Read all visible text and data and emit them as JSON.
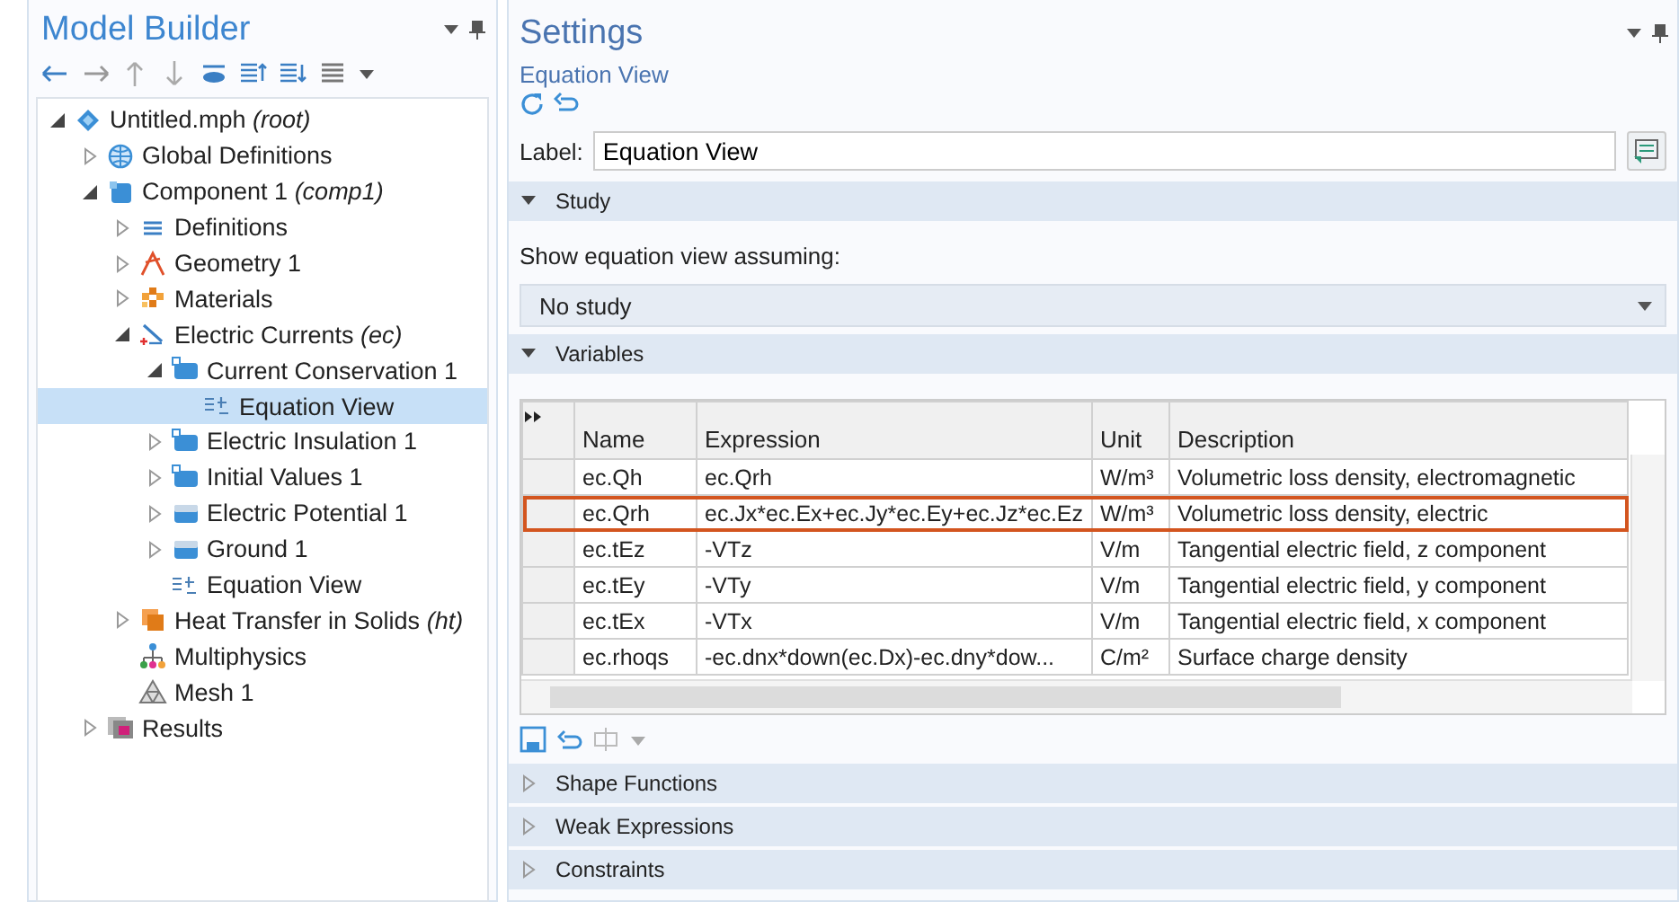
{
  "model_builder": {
    "title": "Model Builder",
    "tree": [
      {
        "label": "Untitled.mph *(root)*",
        "kind": "model",
        "expanded": true,
        "selected": false,
        "children": [
          {
            "label": "Global Definitions",
            "kind": "globe",
            "expanded": false,
            "selected": false
          },
          {
            "label": "Component 1 *(comp1)*",
            "kind": "component",
            "expanded": true,
            "selected": false,
            "children": [
              {
                "label": "Definitions",
                "kind": "list",
                "expanded": false,
                "selected": false
              },
              {
                "label": "Geometry 1",
                "kind": "geometry",
                "expanded": false,
                "selected": false
              },
              {
                "label": "Materials",
                "kind": "materials",
                "expanded": false,
                "selected": false
              },
              {
                "label": "Electric Currents *(ec)*",
                "kind": "physics",
                "expanded": true,
                "selected": false,
                "children": [
                  {
                    "label": "Current Conservation 1",
                    "kind": "domain",
                    "expanded": true,
                    "selected": false,
                    "children": [
                      {
                        "label": "Equation View",
                        "kind": "equation",
                        "selected": true
                      }
                    ]
                  },
                  {
                    "label": "Electric Insulation 1",
                    "kind": "domain",
                    "expanded": false,
                    "selected": false
                  },
                  {
                    "label": "Initial Values 1",
                    "kind": "domain",
                    "expanded": false,
                    "selected": false
                  },
                  {
                    "label": "Electric Potential 1",
                    "kind": "boundary",
                    "expanded": false,
                    "selected": false
                  },
                  {
                    "label": "Ground 1",
                    "kind": "boundary",
                    "expanded": false,
                    "selected": false
                  },
                  {
                    "label": "Equation View",
                    "kind": "equation",
                    "selected": false
                  }
                ]
              },
              {
                "label": "Heat Transfer in Solids *(ht)*",
                "kind": "heat",
                "expanded": false,
                "selected": false
              },
              {
                "label": "Multiphysics",
                "kind": "multiphysics",
                "selected": false
              },
              {
                "label": "Mesh 1",
                "kind": "mesh",
                "selected": false
              }
            ]
          },
          {
            "label": "Results",
            "kind": "results",
            "expanded": false,
            "selected": false
          }
        ]
      }
    ]
  },
  "settings": {
    "title": "Settings",
    "subtitle": "Equation View",
    "label": {
      "text": "Label:",
      "value": "Equation View"
    },
    "study": {
      "title": "Study",
      "expanded": true,
      "prompt": "Show equation view assuming:",
      "dropdown": {
        "value": "No study"
      }
    },
    "variables": {
      "title": "Variables",
      "expanded": true,
      "table": {
        "columns": [
          "Name",
          "Expression",
          "Unit",
          "Description"
        ],
        "rows": [
          {
            "cells": [
              "ec.Qh",
              "ec.Qrh",
              "W/m³",
              "Volumetric loss density, electromagnetic"
            ],
            "highlighted": false
          },
          {
            "cells": [
              "ec.Qrh",
              "ec.Jx*ec.Ex+ec.Jy*ec.Ey+ec.Jz*ec.Ez",
              "W/m³",
              "Volumetric loss density, electric"
            ],
            "highlighted": true
          },
          {
            "cells": [
              "ec.tEz",
              "-VTz",
              "V/m",
              "Tangential electric field, z component"
            ],
            "highlighted": false
          },
          {
            "cells": [
              "ec.tEy",
              "-VTy",
              "V/m",
              "Tangential electric field, y component"
            ],
            "highlighted": false
          },
          {
            "cells": [
              "ec.tEx",
              "-VTx",
              "V/m",
              "Tangential electric field, x component"
            ],
            "highlighted": false
          },
          {
            "cells": [
              "ec.rhoqs",
              "-ec.dnx*down(ec.Dx)-ec.dny*dow...",
              "C/m²",
              "Surface charge density"
            ],
            "highlighted": false
          }
        ]
      }
    },
    "sections": [
      {
        "title": "Shape Functions",
        "expanded": false
      },
      {
        "title": "Weak Expressions",
        "expanded": false
      },
      {
        "title": "Constraints",
        "expanded": false
      }
    ]
  }
}
